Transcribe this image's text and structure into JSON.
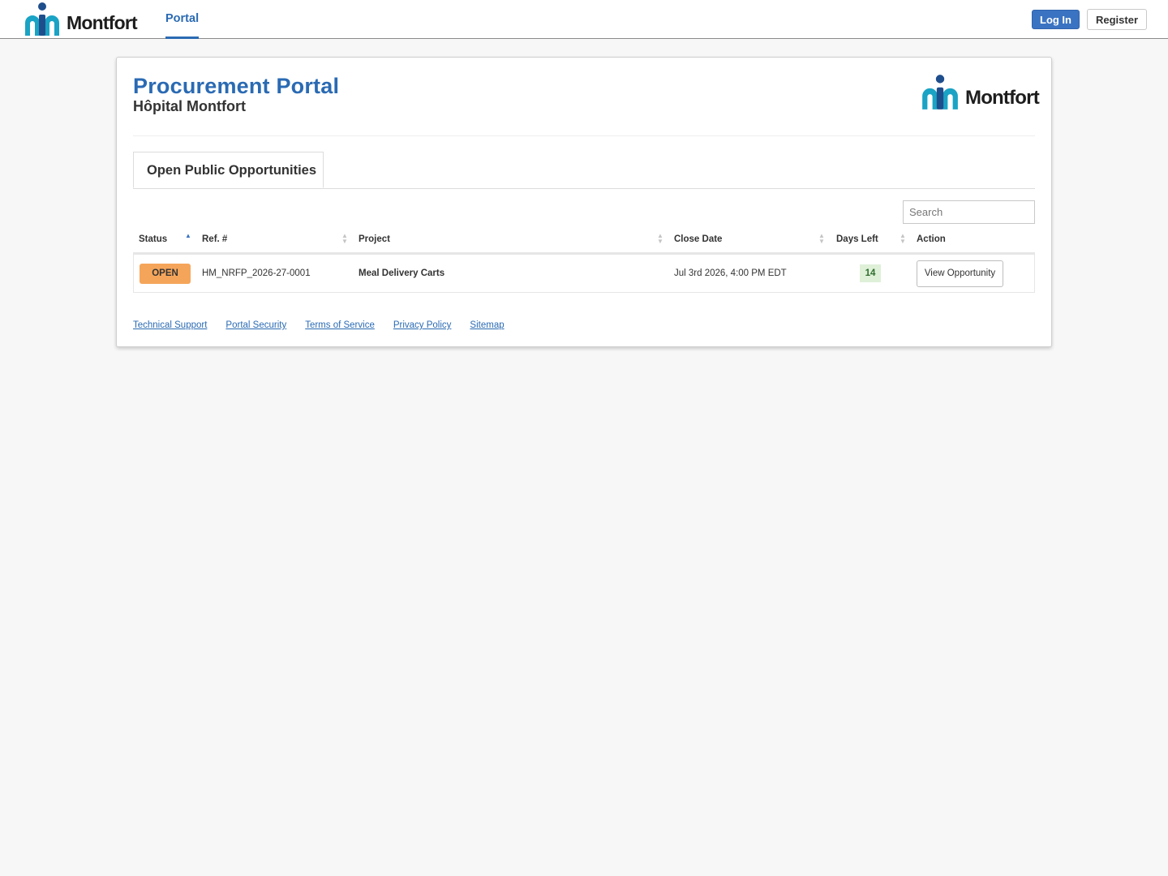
{
  "brand": {
    "name": "Montfort",
    "teal": "#1aa3c4",
    "navy": "#1f4e8c"
  },
  "nav": {
    "portal_label": "Portal"
  },
  "auth": {
    "login_label": "Log In",
    "register_label": "Register"
  },
  "header": {
    "title": "Procurement Portal",
    "subtitle": "Hôpital Montfort"
  },
  "tabs": [
    {
      "label": "Open Public Opportunities",
      "active": true
    }
  ],
  "search": {
    "placeholder": "Search",
    "value": ""
  },
  "table": {
    "columns": [
      "Status",
      "Ref. #",
      "Project",
      "Close Date",
      "Days Left",
      "Action"
    ],
    "sorted_column": "Status",
    "sort_direction": "asc",
    "rows": [
      {
        "status": "OPEN",
        "ref": "HM_NRFP_2026-27-0001",
        "project": "Meal Delivery Carts",
        "close_date": "Jul 3rd 2026, 4:00 PM EDT",
        "days_left": "14",
        "action": "View Opportunity"
      }
    ]
  },
  "footer": {
    "links": [
      "Technical Support",
      "Portal Security",
      "Terms of Service",
      "Privacy Policy",
      "Sitemap"
    ]
  },
  "colors": {
    "accent": "#2a6ab3",
    "status_open": "#f5a55a",
    "days_left_bg": "#dff0d8"
  },
  "icons": {
    "sort_asc": "sort-asc-icon",
    "sort_both": "sort-icon"
  }
}
